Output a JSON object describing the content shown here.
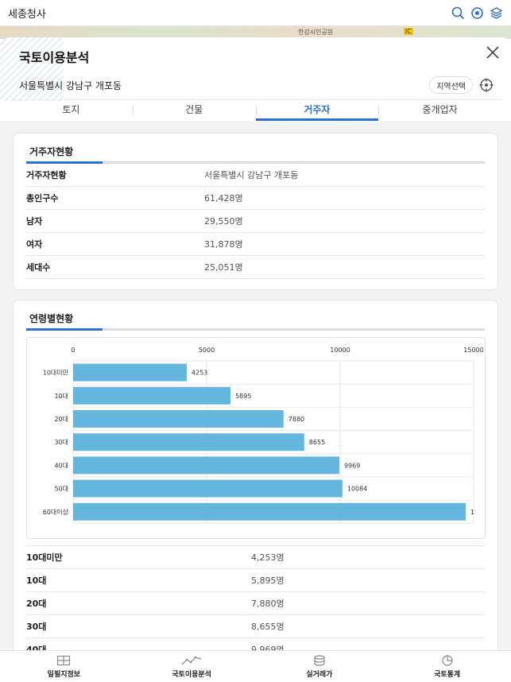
{
  "app": {
    "title": "세종청사"
  },
  "map": {
    "labels": [
      "한강시민공원",
      "IC"
    ]
  },
  "panel": {
    "title": "국토이용분석",
    "region": "서울특별시 강남구 개포동",
    "region_button": "지역선택",
    "tabs": [
      {
        "label": "토지"
      },
      {
        "label": "건물"
      },
      {
        "label": "거주자"
      },
      {
        "label": "중개업자"
      }
    ],
    "active_tab": 2
  },
  "residents": {
    "title": "거주자현황",
    "rows": [
      {
        "label": "거주자현황",
        "value": "서울특별시 강남구 개포동"
      },
      {
        "label": "총인구수",
        "value": "61,428명"
      },
      {
        "label": "남자",
        "value": "29,550명"
      },
      {
        "label": "여자",
        "value": "31,878명"
      },
      {
        "label": "세대수",
        "value": "25,051명"
      }
    ]
  },
  "age": {
    "title": "연령별현황",
    "rows": [
      {
        "label": "10대미만",
        "value": "4,253명"
      },
      {
        "label": "10대",
        "value": "5,895명"
      },
      {
        "label": "20대",
        "value": "7,880명"
      },
      {
        "label": "30대",
        "value": "8,655명"
      },
      {
        "label": "40대",
        "value": "9,969명"
      }
    ]
  },
  "chart_data": {
    "type": "bar",
    "orientation": "horizontal",
    "categories": [
      "10대미만",
      "10대",
      "20대",
      "30대",
      "40대",
      "50대",
      "60대이상"
    ],
    "values": [
      4253,
      5895,
      7880,
      8655,
      9969,
      10084,
      14700
    ],
    "value_labels": [
      "4253",
      "5895",
      "7880",
      "8655",
      "9969",
      "10084",
      "1"
    ],
    "ticks": [
      0,
      5000,
      10000,
      15000
    ],
    "xlim": [
      0,
      15000
    ],
    "bar_color": "#65b6de",
    "grid": true
  },
  "bottom_nav": [
    {
      "label": "일필지정보",
      "icon": "map-grid-icon"
    },
    {
      "label": "국토이용분석",
      "icon": "line-trend-icon"
    },
    {
      "label": "실거래가",
      "icon": "coin-stack-icon"
    },
    {
      "label": "국토통계",
      "icon": "pie-chart-icon"
    }
  ],
  "colors": {
    "accent": "#2d6fd0",
    "bar": "#65b6de"
  }
}
